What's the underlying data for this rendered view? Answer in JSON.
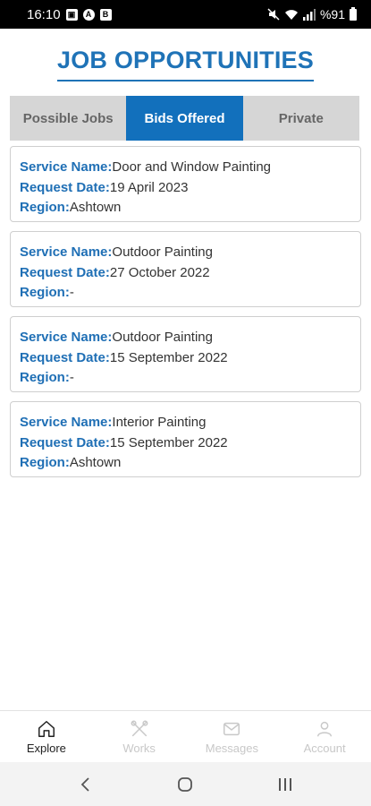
{
  "status_bar": {
    "time": "16:10",
    "battery_text": "%91",
    "left_icons": [
      "photo-icon",
      "a-icon",
      "b-icon"
    ],
    "right_icons": [
      "mute-icon",
      "wifi-icon",
      "signal-icon",
      "battery-icon"
    ]
  },
  "header": {
    "title": "JOB OPPORTUNITIES"
  },
  "tabs": [
    {
      "label": "Possible Jobs",
      "active": false
    },
    {
      "label": "Bids Offered",
      "active": true
    },
    {
      "label": "Private",
      "active": false
    }
  ],
  "labels": {
    "service_name": "Service Name:",
    "request_date": "Request Date:",
    "region": "Region:"
  },
  "jobs": [
    {
      "service_name": "Door and Window Painting",
      "request_date": "19 April 2023",
      "region": "Ashtown"
    },
    {
      "service_name": "Outdoor Painting",
      "request_date": "27 October 2022",
      "region": "-"
    },
    {
      "service_name": "Outdoor Painting",
      "request_date": "15 September 2022",
      "region": "-"
    },
    {
      "service_name": "Interior Painting",
      "request_date": "15 September 2022",
      "region": "Ashtown"
    }
  ],
  "bottom_nav": [
    {
      "label": "Explore",
      "icon": "home-icon",
      "active": true
    },
    {
      "label": "Works",
      "icon": "tools-icon",
      "active": false
    },
    {
      "label": "Messages",
      "icon": "mail-icon",
      "active": false
    },
    {
      "label": "Account",
      "icon": "user-icon",
      "active": false
    }
  ],
  "colors": {
    "accent": "#1f73b7",
    "tab_active": "#1270bc",
    "tab_inactive": "#d6d6d6"
  }
}
